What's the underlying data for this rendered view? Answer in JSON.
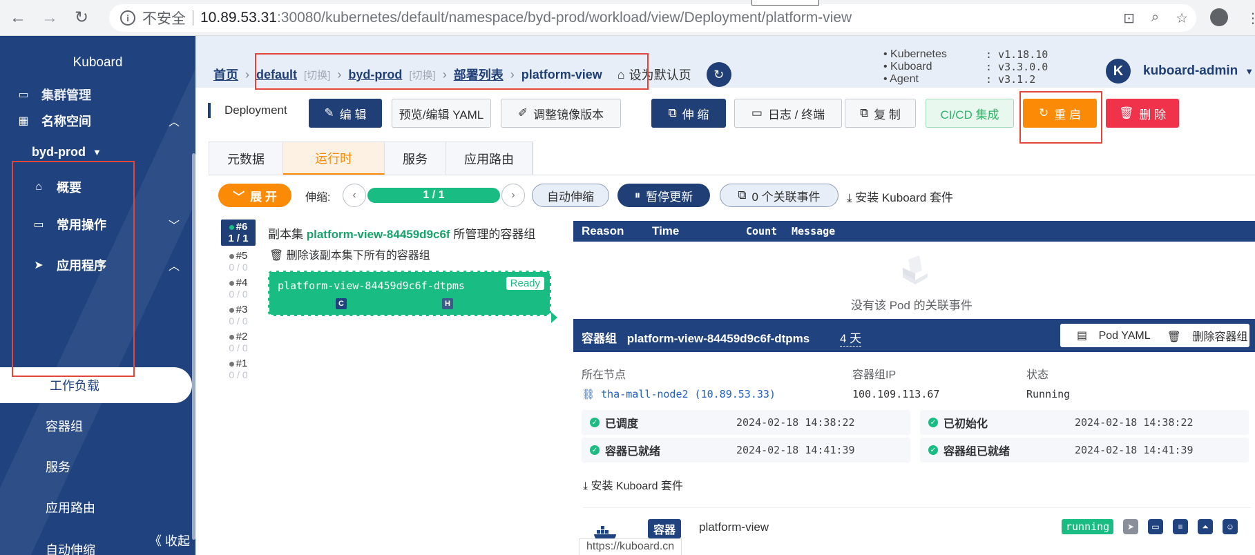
{
  "browser": {
    "insecure_label": "不安全",
    "url_host": "10.89.53.31",
    "url_rest": ":30080/kubernetes/default/namespace/byd-prod/workload/view/Deployment/platform-view"
  },
  "sidebar": {
    "brand": "Kuboard",
    "cluster_mgmt": "集群管理",
    "namespace_section": "名称空间",
    "namespace_current": "byd-prod",
    "overview": "概要",
    "common_ops": "常用操作",
    "apps": "应用程序",
    "workloads": "工作负载",
    "pods": "容器组",
    "services": "服务",
    "ingress": "应用路由",
    "autoscale": "自动伸缩",
    "collapse": "《 收起"
  },
  "header": {
    "home": "首页",
    "cluster": "default",
    "switch": "[切换]",
    "namespace": "byd-prod",
    "deploy_list": "部署列表",
    "current": "platform-view",
    "set_default": "设为默认页",
    "versions": [
      {
        "k": "Kubernetes",
        "v": ": v1.18.10"
      },
      {
        "k": "Kuboard",
        "v": ": v3.3.0.0"
      },
      {
        "k": "Agent",
        "v": ": v3.1.2"
      }
    ],
    "avatar_letter": "K",
    "user": "kuboard-admin"
  },
  "toolbar": {
    "kind": "Deployment",
    "edit": "编 辑",
    "yaml": "预览/编辑 YAML",
    "image": "调整镜像版本",
    "scale": "伸 缩",
    "logs": "日志 / 终端",
    "copy": "复 制",
    "cicd": "CI/CD 集成",
    "restart": "重 启",
    "delete": "删 除"
  },
  "tabs": [
    "元数据",
    "运行时",
    "服务",
    "应用路由"
  ],
  "runtime": {
    "expand": "展 开",
    "scale_label": "伸缩:",
    "replicas": "1 / 1",
    "autoscale": "自动伸缩",
    "pause": "暂停更新",
    "events": "0 个关联事件",
    "install_kuboard": "安装 Kuboard 套件"
  },
  "replicasets": {
    "current": {
      "rev": "#6",
      "count": "1 / 1"
    },
    "history": [
      {
        "rev": "#5",
        "count": "0 / 0"
      },
      {
        "rev": "#4",
        "count": "0 / 0"
      },
      {
        "rev": "#3",
        "count": "0 / 0"
      },
      {
        "rev": "#2",
        "count": "0 / 0"
      },
      {
        "rev": "#1",
        "count": "0 / 0"
      }
    ],
    "title_prefix": "副本集",
    "rs_name": "platform-view-84459d9c6f",
    "title_suffix": "所管理的容器组",
    "delete_all": "删除该副本集下所有的容器组",
    "pod_name": "platform-view-84459d9c6f-dtpms",
    "ready": "Ready",
    "badge_c": "C",
    "badge_h": "H"
  },
  "events": {
    "columns": [
      "Reason",
      "Time",
      "Count",
      "Message"
    ],
    "empty": "没有该 Pod 的关联事件"
  },
  "pod": {
    "label": "容器组",
    "name": "platform-view-84459d9c6f-dtpms",
    "age": "4 天",
    "yaml_btn": "Pod YAML",
    "delete_btn": "删除容器组",
    "node_label": "所在节点",
    "ip_label": "容器组IP",
    "status_label": "状态",
    "node": "tha-mall-node2 (10.89.53.33)",
    "ip": "100.109.113.67",
    "status": "Running",
    "conditions": [
      {
        "label": "已调度",
        "time": "2024-02-18 14:38:22"
      },
      {
        "label": "已初始化",
        "time": "2024-02-18 14:38:22"
      },
      {
        "label": "容器已就绪",
        "time": "2024-02-18 14:41:39"
      },
      {
        "label": "容器组已就绪",
        "time": "2024-02-18 14:41:39"
      }
    ],
    "install_kuboard": "安装 Kuboard 套件",
    "container_tag": "容器",
    "container_name": "platform-view",
    "container_state": "running"
  },
  "statusbar": "https://kuboard.cn",
  "colors": {
    "navy": "#20437f",
    "orange": "#fb8b06",
    "green": "#19bd83",
    "red": "#f0334a",
    "annotation": "#e2463a"
  }
}
